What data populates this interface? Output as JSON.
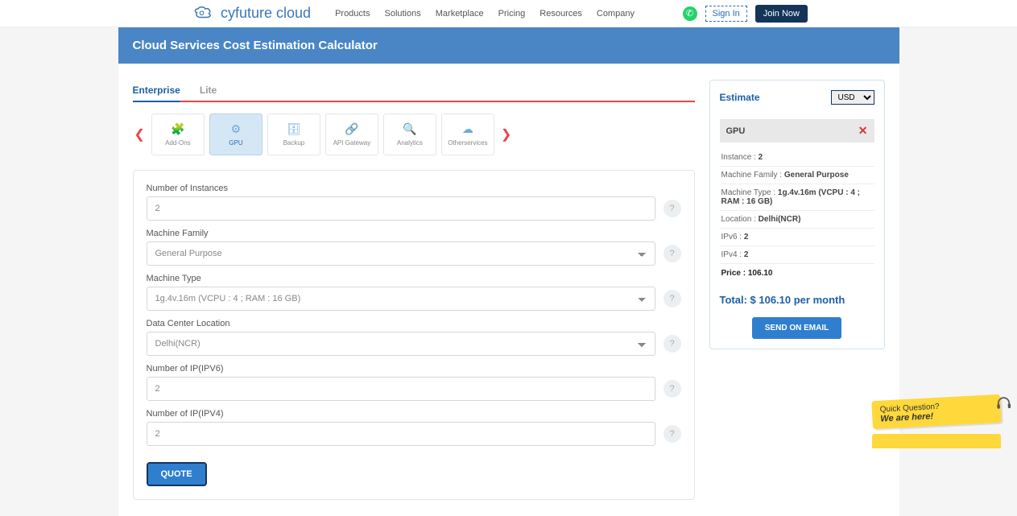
{
  "header": {
    "logo_text": "cyfuture cloud",
    "nav": [
      "Products",
      "Solutions",
      "Marketplace",
      "Pricing",
      "Resources",
      "Company"
    ],
    "signin": "Sign In",
    "joinnow": "Join Now"
  },
  "page_title": "Cloud Services Cost Estimation Calculator",
  "tabs": {
    "enterprise": "Enterprise",
    "lite": "Lite"
  },
  "services": {
    "items": [
      {
        "label": "Add-Ons"
      },
      {
        "label": "GPU"
      },
      {
        "label": "Backup"
      },
      {
        "label": "API Gateway"
      },
      {
        "label": "Analytics"
      },
      {
        "label": "Otherservices"
      }
    ]
  },
  "form": {
    "instances_label": "Number of Instances",
    "instances_value": "2",
    "machine_family_label": "Machine Family",
    "machine_family_value": "General Purpose",
    "machine_type_label": "Machine Type",
    "machine_type_value": "1g.4v.16m (VCPU : 4 ; RAM : 16 GB)",
    "location_label": "Data Center Location",
    "location_value": "Delhi(NCR)",
    "ipv6_label": "Number of IP(IPV6)",
    "ipv6_value": "2",
    "ipv4_label": "Number of IP(IPV4)",
    "ipv4_value": "2",
    "quote_button": "QUOTE"
  },
  "estimate": {
    "title": "Estimate",
    "currency": "USD",
    "item_name": "GPU",
    "lines": {
      "instance_k": "Instance : ",
      "instance_v": "2",
      "mf_k": "Machine Family : ",
      "mf_v": "General Purpose",
      "mt_k": "Machine Type : ",
      "mt_v": "1g.4v.16m (VCPU : 4 ; RAM : 16 GB)",
      "loc_k": "Location : ",
      "loc_v": "Delhi(NCR)",
      "ipv6_k": "IPv6 : ",
      "ipv6_v": "2",
      "ipv4_k": "IPv4 : ",
      "ipv4_v": "2"
    },
    "price_label": "Price : ",
    "price_value": "106.10",
    "total": "Total: $ 106.10 per month",
    "send_button": "SEND ON EMAIL"
  },
  "chat": {
    "line1": "Quick Question?",
    "line2": "We are here!"
  }
}
